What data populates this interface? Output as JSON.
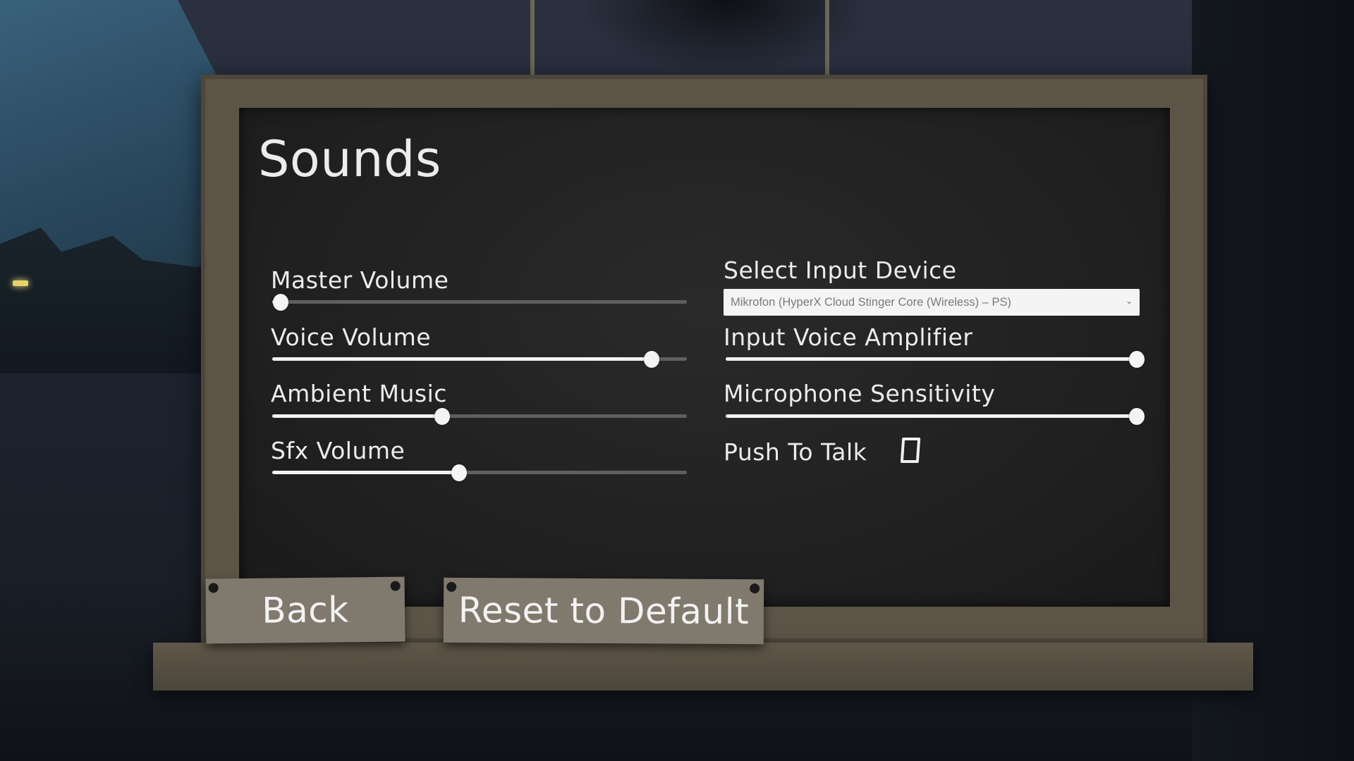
{
  "menu": {
    "title": "Sounds"
  },
  "left_sliders": [
    {
      "label": "Master Volume",
      "value": 0.02
    },
    {
      "label": "Voice Volume",
      "value": 0.915
    },
    {
      "label": "Ambient Music",
      "value": 0.41
    },
    {
      "label": "Sfx Volume",
      "value": 0.45
    }
  ],
  "input_device": {
    "label": "Select Input Device",
    "selected": "Mikrofon (HyperX Cloud Stinger Core (Wireless) – PS)"
  },
  "right_sliders": [
    {
      "label": "Input Voice Amplifier",
      "value": 0.985
    },
    {
      "label": "Microphone Sensitivity",
      "value": 0.985
    }
  ],
  "push_to_talk": {
    "label": "Push To Talk",
    "checked": false
  },
  "buttons": {
    "back": "Back",
    "reset": "Reset to Default"
  }
}
